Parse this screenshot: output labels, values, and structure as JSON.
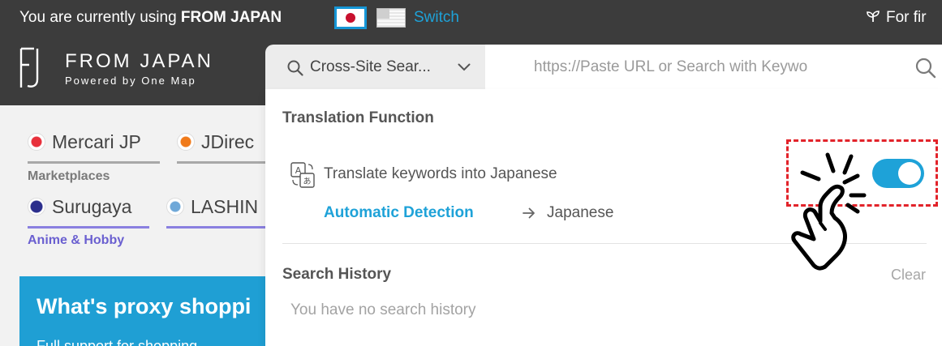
{
  "topbar": {
    "message_prefix": "You are currently using ",
    "message_brand": "FROM JAPAN",
    "switch_label": "Switch",
    "first_time_label": "For fir",
    "icons": {
      "jp_flag": "japan-flag-icon",
      "us_flag": "us-flag-icon",
      "sprout": "sprout-icon"
    }
  },
  "header": {
    "logo_text": "FROM JAPAN",
    "logo_sub": "Powered by One Map"
  },
  "sites": {
    "mercari": "Mercari JP",
    "jdirect": "JDirec",
    "surugaya": "Surugaya",
    "lashin": "LASHIN",
    "marketplaces_label": "Marketplaces",
    "anime_label": "Anime & Hobby"
  },
  "promo": {
    "title": "What's proxy shoppi",
    "text": "Full support for shopping"
  },
  "search": {
    "scope_label": "Cross-Site Sear...",
    "placeholder": "https://Paste URL or Search with Keywo"
  },
  "translation": {
    "title": "Translation Function",
    "label": "Translate keywords into Japanese",
    "source_lang": "Automatic Detection",
    "target_lang": "Japanese",
    "enabled": true
  },
  "history": {
    "title": "Search History",
    "clear_label": "Clear",
    "empty_text": "You have no search history"
  },
  "colors": {
    "topbar_bg": "#3c3c3c",
    "accent_blue": "#1ea2d8",
    "highlight_red": "#e2232a",
    "anime_purple": "#6a5fd0"
  }
}
